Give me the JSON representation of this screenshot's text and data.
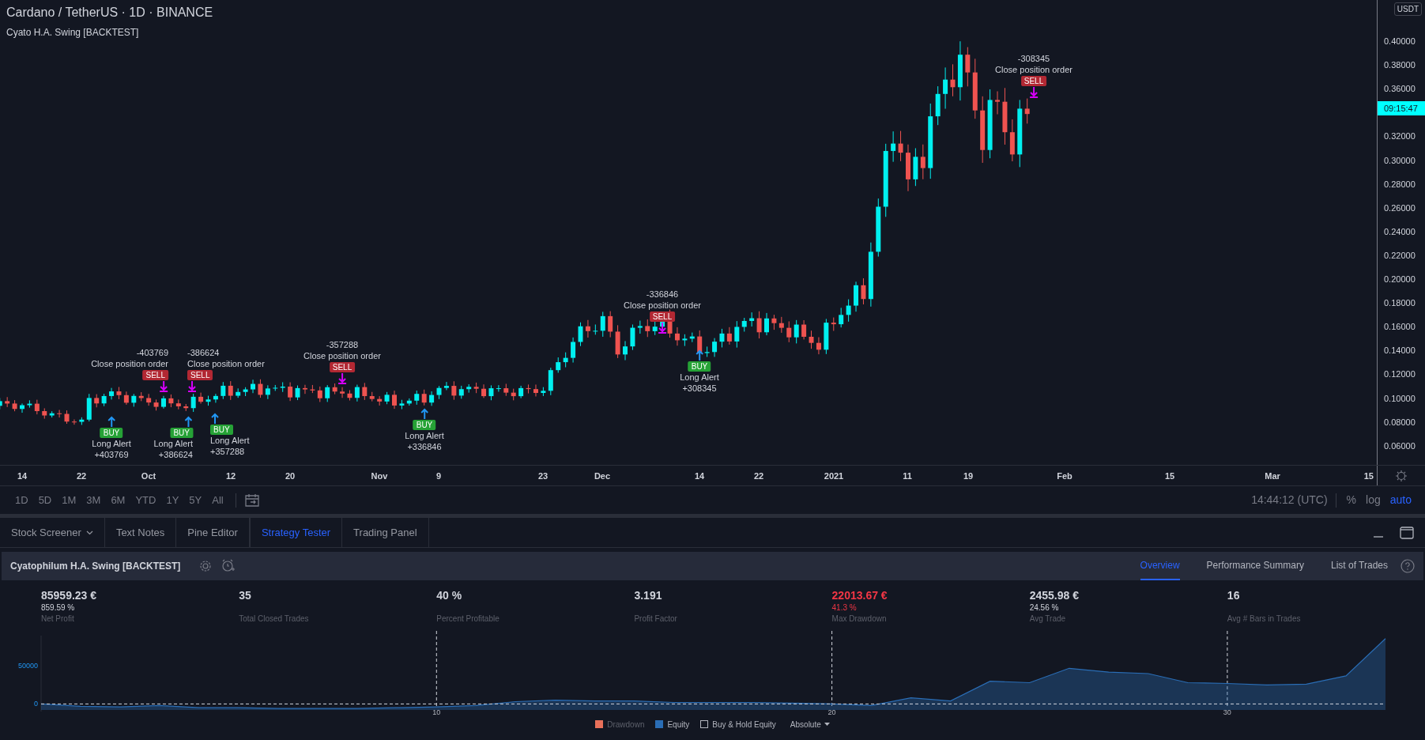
{
  "header": {
    "title": "Cardano / TetherUS · 1D · BINANCE",
    "indicator": "Cyato H.A. Swing [BACKTEST]"
  },
  "orders": [
    {
      "kind": "sell",
      "value": "-403769",
      "label": "Close position order",
      "badge": "SELL"
    },
    {
      "kind": "sell",
      "value": "-386624",
      "label": "Close position order",
      "badge": "SELL"
    },
    {
      "kind": "sell",
      "value": "-357288",
      "label": "Close position order",
      "badge": "SELL"
    },
    {
      "kind": "sell",
      "value": "-336846",
      "label": "Close position order",
      "badge": "SELL"
    },
    {
      "kind": "sell",
      "value": "-308345",
      "label": "Close position order",
      "badge": "SELL"
    },
    {
      "kind": "buy",
      "value": "+403769",
      "label": "Long Alert",
      "badge": "BUY"
    },
    {
      "kind": "buy",
      "value": "+386624",
      "label": "Long Alert",
      "badge": "BUY"
    },
    {
      "kind": "buy",
      "value": "+357288",
      "label": "Long Alert",
      "badge": "BUY"
    },
    {
      "kind": "buy",
      "value": "+336846",
      "label": "Long Alert",
      "badge": "BUY"
    },
    {
      "kind": "buy",
      "value": "+308345",
      "label": "Long Alert",
      "badge": "BUY"
    }
  ],
  "price_axis": {
    "currency": "USDT",
    "last_time": "09:15:47",
    "labels": [
      "0.40000",
      "0.38000",
      "0.36000",
      "0.32000",
      "0.30000",
      "0.28000",
      "0.26000",
      "0.24000",
      "0.22000",
      "0.20000",
      "0.18000",
      "0.16000",
      "0.14000",
      "0.12000",
      "0.10000",
      "0.08000",
      "0.06000"
    ]
  },
  "time_axis": [
    "14",
    "22",
    "Oct",
    "12",
    "20",
    "Nov",
    "9",
    "23",
    "Dec",
    "14",
    "22",
    "2021",
    "11",
    "19",
    "Feb",
    "15",
    "Mar",
    "15"
  ],
  "range_buttons": [
    "1D",
    "5D",
    "1M",
    "3M",
    "6M",
    "YTD",
    "1Y",
    "5Y",
    "All"
  ],
  "clock": "14:44:12 (UTC)",
  "scale_toggles": [
    {
      "label": "%",
      "selected": false
    },
    {
      "label": "log",
      "selected": false
    },
    {
      "label": "auto",
      "selected": true
    }
  ],
  "bottom_tabs": [
    {
      "label": "Stock Screener",
      "selected": false,
      "has_menu": true
    },
    {
      "label": "Text Notes",
      "selected": false,
      "has_menu": false
    },
    {
      "label": "Pine Editor",
      "selected": false,
      "has_menu": false
    },
    {
      "label": "Strategy Tester",
      "selected": true,
      "has_menu": false
    },
    {
      "label": "Trading Panel",
      "selected": false,
      "has_menu": false
    }
  ],
  "strategy": {
    "name": "Cyatophilum H.A. Swing [BACKTEST]",
    "views": [
      {
        "label": "Overview",
        "selected": true
      },
      {
        "label": "Performance Summary",
        "selected": false
      },
      {
        "label": "List of Trades",
        "selected": false
      }
    ],
    "stats": [
      {
        "value": "85959.23 €",
        "change": "859.59 %",
        "label": "Net Profit",
        "kind": "neutral"
      },
      {
        "value": "35",
        "label": "Total Closed Trades",
        "kind": "neutral"
      },
      {
        "value": "40 %",
        "label": "Percent Profitable",
        "kind": "neutral"
      },
      {
        "value": "3.191",
        "label": "Profit Factor",
        "kind": "neutral"
      },
      {
        "value": "22013.67 €",
        "change": "41.3 %",
        "label": "Max Drawdown",
        "kind": "loss"
      },
      {
        "value": "2455.98 €",
        "change": "24.56 %",
        "label": "Avg Trade",
        "kind": "neutral"
      },
      {
        "value": "16",
        "label": "Avg # Bars in Trades",
        "kind": "neutral"
      }
    ]
  },
  "equity_chart": {
    "chart_data": {
      "type": "area",
      "x": [
        0,
        1,
        2,
        3,
        4,
        5,
        6,
        7,
        8,
        9,
        10,
        11,
        12,
        13,
        14,
        15,
        16,
        17,
        18,
        19,
        20,
        21,
        22,
        23,
        24,
        25,
        26,
        27,
        28,
        29,
        30,
        31,
        32,
        33,
        34
      ],
      "series": [
        {
          "name": "Equity",
          "color": "#2a6db5",
          "values": [
            0,
            -3000,
            -4000,
            -2000,
            -5000,
            -5000,
            -6000,
            -6000,
            -6000,
            -5000,
            -4000,
            -2000,
            3000,
            5000,
            4000,
            4000,
            2000,
            2000,
            2000,
            1000,
            0,
            -2000,
            8000,
            4000,
            30000,
            28000,
            47000,
            42000,
            40000,
            28000,
            27000,
            25000,
            26000,
            37000,
            86000
          ]
        }
      ],
      "xticks": [
        10,
        20,
        30
      ],
      "yticks": [
        0,
        50000
      ],
      "xlim": [
        0,
        34
      ],
      "ylim": [
        -10000,
        90000
      ],
      "grid": true
    },
    "legend": [
      {
        "kind": "swatch",
        "label": "Drawdown",
        "color": "#e8705a",
        "disabled": true
      },
      {
        "kind": "checkbox",
        "label": "Buy & Hold Equity",
        "checked": false
      }
    ],
    "mode": "Absolute"
  }
}
